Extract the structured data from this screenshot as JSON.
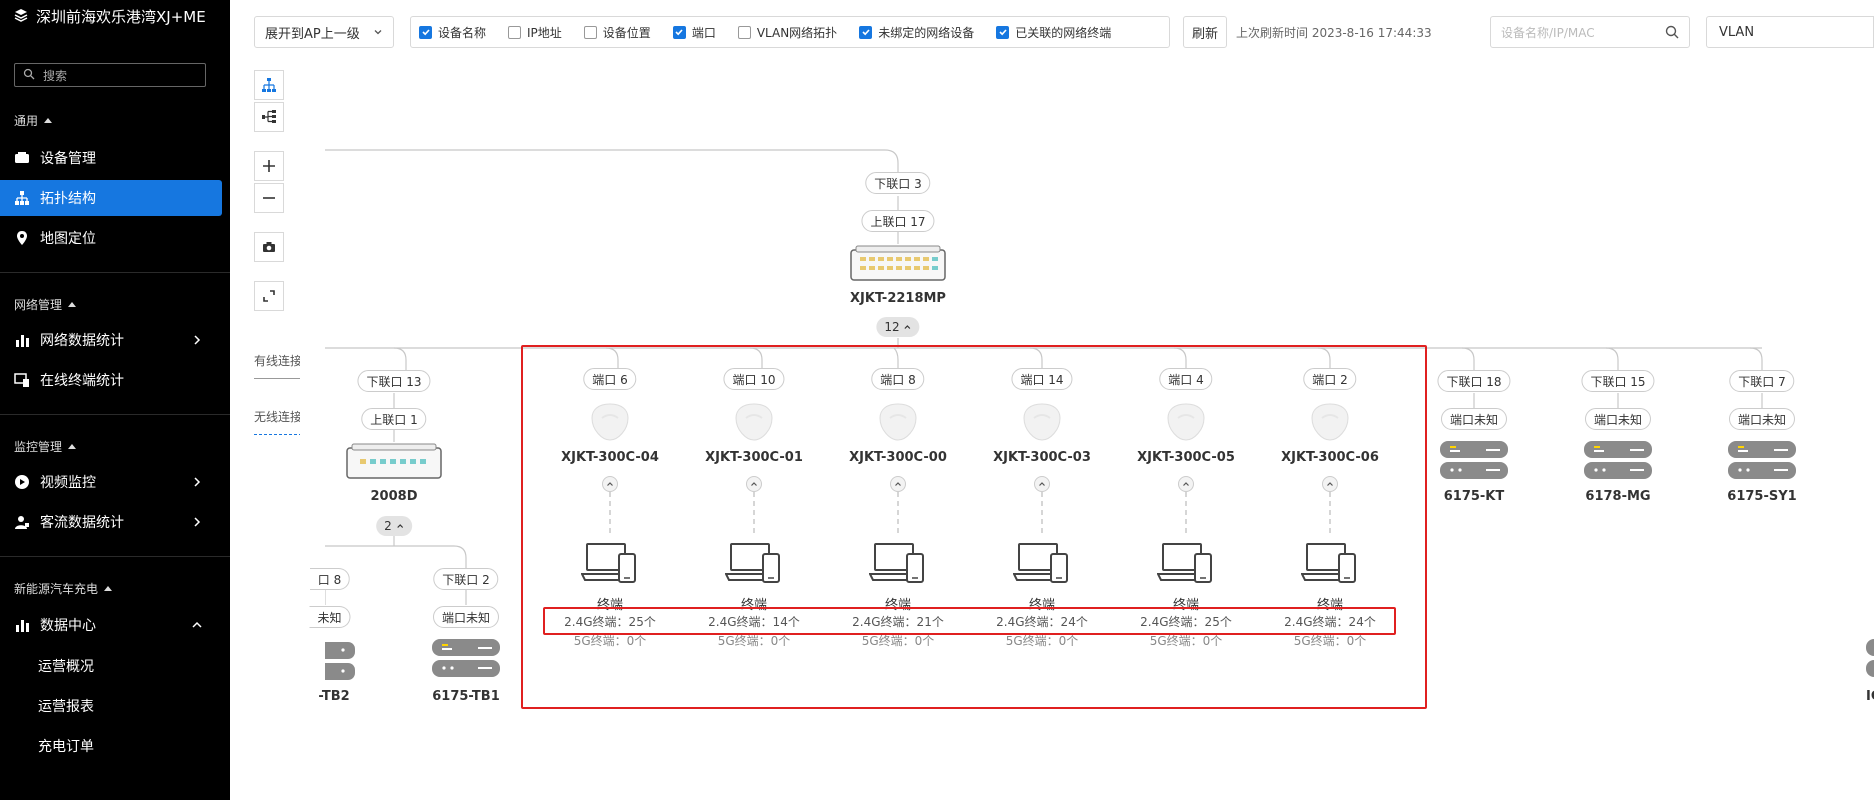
{
  "sidebar": {
    "brand": "深圳前海欢乐港湾XJ+ME",
    "search_placeholder": "搜索",
    "groups": [
      {
        "label": "通用"
      },
      {
        "label": "网络管理"
      },
      {
        "label": "监控管理"
      },
      {
        "label": "新能源汽车充电"
      }
    ],
    "items": [
      {
        "label": "设备管理",
        "icon": "device-icon"
      },
      {
        "label": "拓扑结构",
        "icon": "topology-icon",
        "active": true
      },
      {
        "label": "地图定位",
        "icon": "location-icon"
      },
      {
        "label": "网络数据统计",
        "icon": "bar-chart-icon"
      },
      {
        "label": "在线终端统计",
        "icon": "terminal-icon"
      },
      {
        "label": "视频监控",
        "icon": "play-icon"
      },
      {
        "label": "客流数据统计",
        "icon": "people-icon"
      },
      {
        "label": "数据中心",
        "icon": "bar-chart-icon"
      }
    ],
    "sub_items": [
      "运营概况",
      "运营报表",
      "充电订单"
    ]
  },
  "toolbar": {
    "expand_select": "展开到AP上一级",
    "filters": [
      {
        "label": "设备名称",
        "checked": true
      },
      {
        "label": "IP地址",
        "checked": false
      },
      {
        "label": "设备位置",
        "checked": false
      },
      {
        "label": "端口",
        "checked": true
      },
      {
        "label": "VLAN网络拓扑",
        "checked": false
      },
      {
        "label": "未绑定的网络设备",
        "checked": true
      },
      {
        "label": "已关联的网络终端",
        "checked": true
      }
    ],
    "refresh_label": "刷新",
    "last_refresh": "上次刷新时间 2023-8-16 17:44:33",
    "search_placeholder": "设备名称/IP/MAC",
    "vlan_select": "VLAN"
  },
  "left_tabs": {
    "wired": "有线连接",
    "wireless": "无线连接"
  },
  "topology": {
    "root": {
      "down_port": "下联口 3",
      "up_port": "上联口 17",
      "name": "XJKT-2218MP",
      "child_count": "12"
    },
    "switch_2008d": {
      "down_port": "下联口 13",
      "up_port": "上联口 1",
      "name": "2008D",
      "child_count": "2"
    },
    "partial_left": {
      "port": "口 8",
      "port2": "未知",
      "name": "-TB2"
    },
    "tb1": {
      "port": "下联口 2",
      "port2": "端口未知",
      "name": "6175-TB1"
    },
    "aps": [
      {
        "port": "端口 6",
        "name": "XJKT-300C-04",
        "terminal": "终端",
        "g24": "2.4G终端：25个",
        "g5": "5G终端：0个"
      },
      {
        "port": "端口 10",
        "name": "XJKT-300C-01",
        "terminal": "终端",
        "g24": "2.4G终端：14个",
        "g5": "5G终端：0个"
      },
      {
        "port": "端口 8",
        "name": "XJKT-300C-00",
        "terminal": "终端",
        "g24": "2.4G终端：21个",
        "g5": "5G终端：0个"
      },
      {
        "port": "端口 14",
        "name": "XJKT-300C-03",
        "terminal": "终端",
        "g24": "2.4G终端：24个",
        "g5": "5G终端：0个"
      },
      {
        "port": "端口 4",
        "name": "XJKT-300C-05",
        "terminal": "终端",
        "g24": "2.4G终端：25个",
        "g5": "5G终端：0个"
      },
      {
        "port": "端口 2",
        "name": "XJKT-300C-06",
        "terminal": "终端",
        "g24": "2.4G终端：24个",
        "g5": "5G终端：0个"
      }
    ],
    "servers": [
      {
        "port": "下联口 18",
        "port2": "端口未知",
        "name": "6175-KT"
      },
      {
        "port": "下联口 15",
        "port2": "端口未知",
        "name": "6178-MG"
      },
      {
        "port": "下联口 7",
        "port2": "端口未知",
        "name": "6175-SY1"
      }
    ],
    "partial_right": {
      "name": "IGS"
    }
  },
  "colors": {
    "accent": "#1677e0",
    "highlight": "#e02020",
    "sidebar_bg": "#000000"
  }
}
